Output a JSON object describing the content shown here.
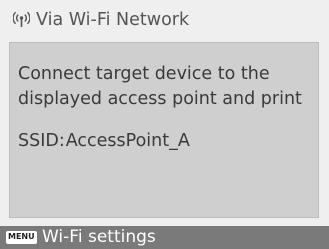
{
  "header": {
    "icon": "wifi-signal-icon",
    "title": "Via Wi-Fi Network"
  },
  "message": {
    "line1": "Connect target device to the",
    "line2": "displayed access point and print"
  },
  "ssid": {
    "label": "SSID:",
    "value": "AccessPoint_A"
  },
  "footer": {
    "button_label": "MENU",
    "action_label": "Wi-Fi settings"
  },
  "colors": {
    "background": "#efefef",
    "panel": "#cfcfcf",
    "footer_bar": "#7a7a7a",
    "text": "#3a3a3a"
  }
}
